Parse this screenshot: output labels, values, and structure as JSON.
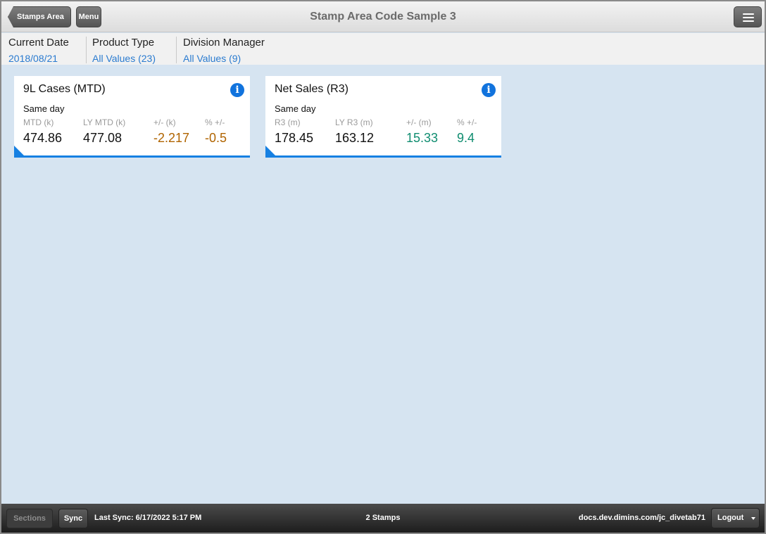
{
  "header": {
    "back_label": "Stamps Area",
    "menu_label": "Menu",
    "title": "Stamp Area Code Sample 3"
  },
  "filters": [
    {
      "label": "Current Date",
      "value": "2018/08/21"
    },
    {
      "label": "Product Type",
      "value": "All Values (23)"
    },
    {
      "label": "Division Manager",
      "value": "All Values (9)"
    }
  ],
  "stamps": [
    {
      "title": "9L Cases (MTD)",
      "subtitle": "Same day",
      "columns": [
        {
          "label": "MTD (k)",
          "value": "474.86"
        },
        {
          "label": "LY MTD (k)",
          "value": "477.08"
        },
        {
          "label": "+/- (k)",
          "value": "-2.217"
        },
        {
          "label": "% +/-",
          "value": "-0.5"
        }
      ]
    },
    {
      "title": "Net Sales (R3)",
      "subtitle": "Same day",
      "columns": [
        {
          "label": "R3 (m)",
          "value": "178.45"
        },
        {
          "label": "LY R3 (m)",
          "value": "163.12"
        },
        {
          "label": "+/- (m)",
          "value": "15.33"
        },
        {
          "label": "% +/-",
          "value": "9.4"
        }
      ]
    }
  ],
  "footer": {
    "sections_label": "Sections",
    "sync_label": "Sync",
    "last_sync": "Last Sync: 6/17/2022 5:17 PM",
    "stamp_count": "2 Stamps",
    "server": "docs.dev.dimins.com/jc_divetab71",
    "logout_label": "Logout"
  },
  "colors": {
    "accent": "#1680e2",
    "link": "#2a7bd0",
    "negative": "#b06400",
    "positive": "#108d70",
    "canvas": "#d6e4f1"
  },
  "icons": {
    "info": "info-icon",
    "hamburger": "hamburger-menu-icon",
    "caret": "caret-down-icon"
  }
}
